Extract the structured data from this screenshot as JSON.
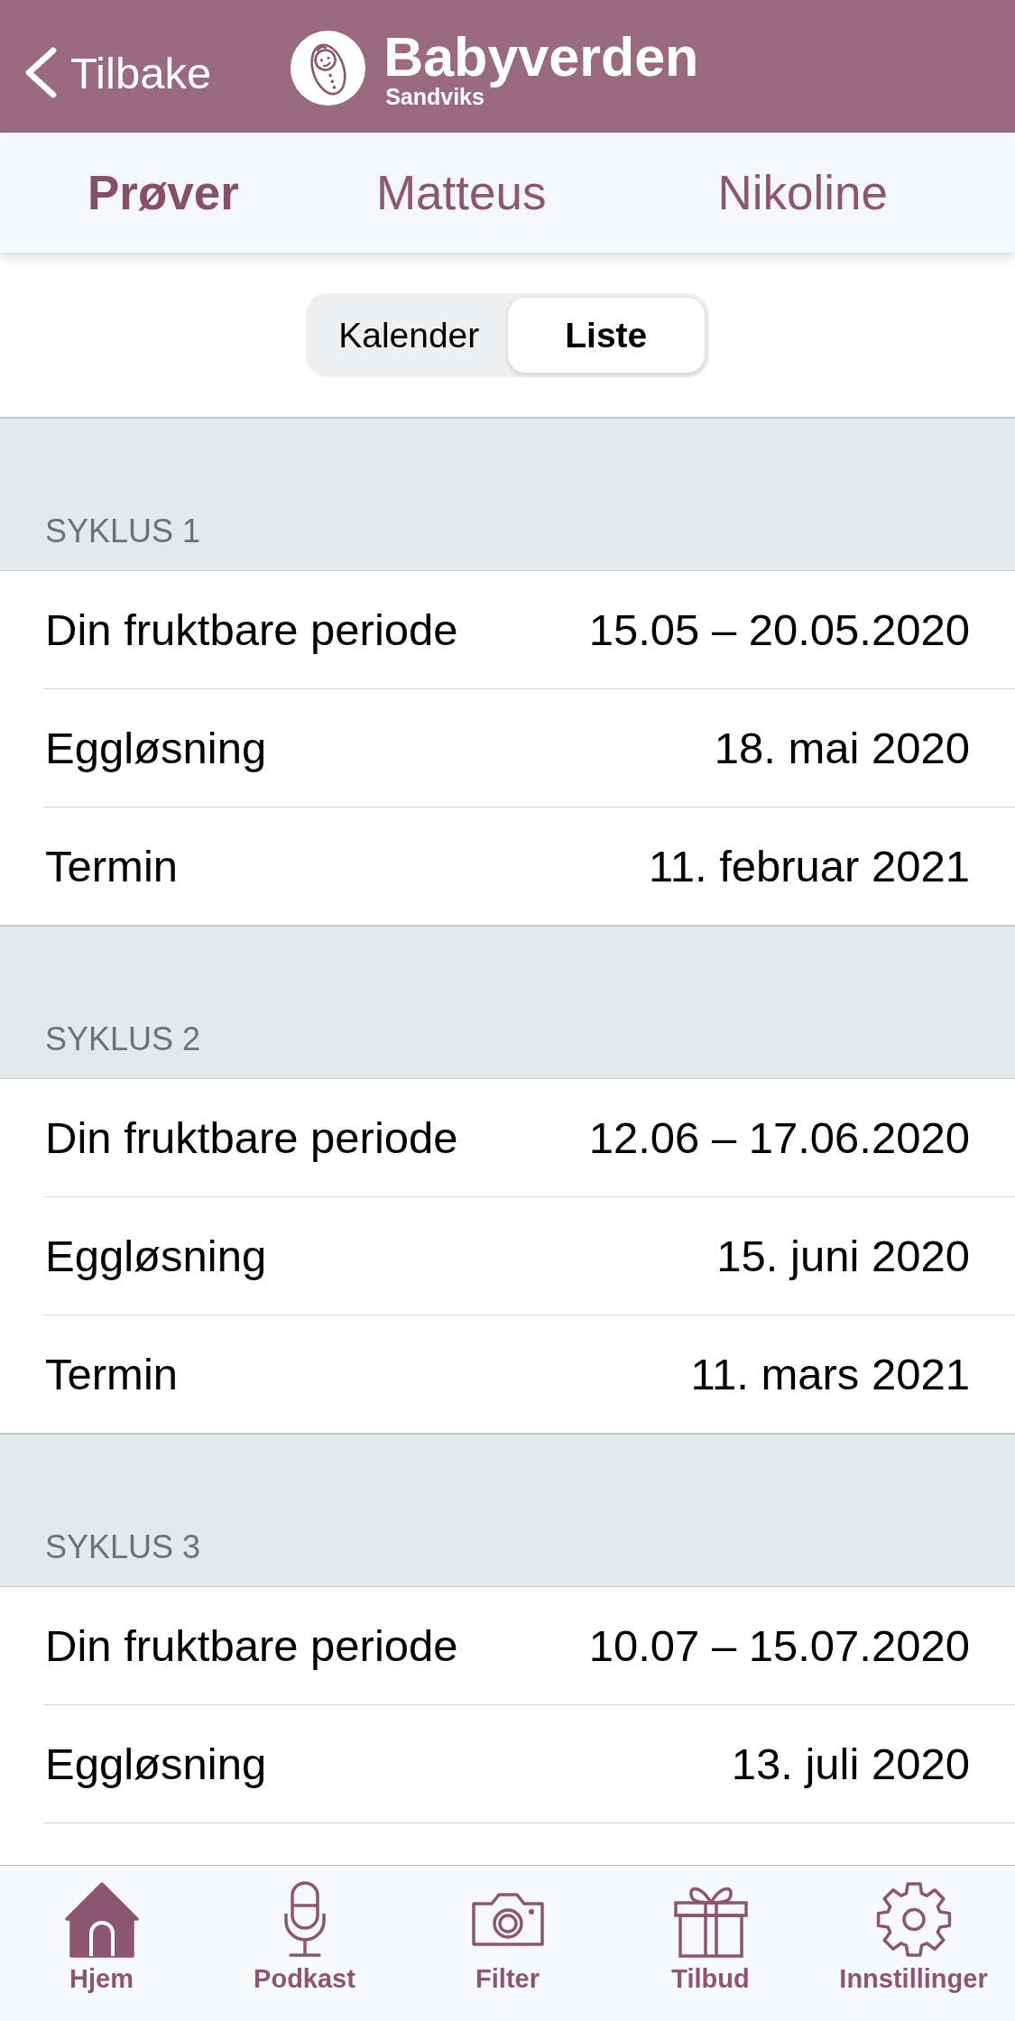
{
  "nav_bar": {
    "back_label": "Tilbake",
    "logo_title": "Babyverden",
    "logo_subtitle": "Sandviks"
  },
  "tabs": [
    {
      "label": "Prøver",
      "selected": true
    },
    {
      "label": "Matteus",
      "selected": false
    },
    {
      "label": "Nikoline",
      "selected": false
    }
  ],
  "view_toggle": [
    {
      "label": "Kalender",
      "selected": false
    },
    {
      "label": "Liste",
      "selected": true
    }
  ],
  "cycles": [
    {
      "title": "SYKLUS 1",
      "rows": [
        {
          "label": "Din fruktbare periode",
          "value": "15.05 – 20.05.2020"
        },
        {
          "label": "Eggløsning",
          "value": "18. mai 2020"
        },
        {
          "label": "Termin",
          "value": "11. februar 2021"
        }
      ]
    },
    {
      "title": "SYKLUS 2",
      "rows": [
        {
          "label": "Din fruktbare periode",
          "value": "12.06 – 17.06.2020"
        },
        {
          "label": "Eggløsning",
          "value": "15. juni 2020"
        },
        {
          "label": "Termin",
          "value": "11. mars 2021"
        }
      ]
    },
    {
      "title": "SYKLUS 3",
      "rows": [
        {
          "label": "Din fruktbare periode",
          "value": "10.07 – 15.07.2020"
        },
        {
          "label": "Eggløsning",
          "value": "13. juli 2020"
        }
      ]
    }
  ],
  "tab_bar": [
    {
      "label": "Hjem",
      "kind": "home",
      "selected": true
    },
    {
      "label": "Podkast",
      "kind": "microphone",
      "selected": false
    },
    {
      "label": "Filter",
      "kind": "camera",
      "selected": false
    },
    {
      "label": "Tilbud",
      "kind": "gift",
      "selected": false
    },
    {
      "label": "Innstillinger",
      "kind": "gear",
      "selected": false
    }
  ]
}
